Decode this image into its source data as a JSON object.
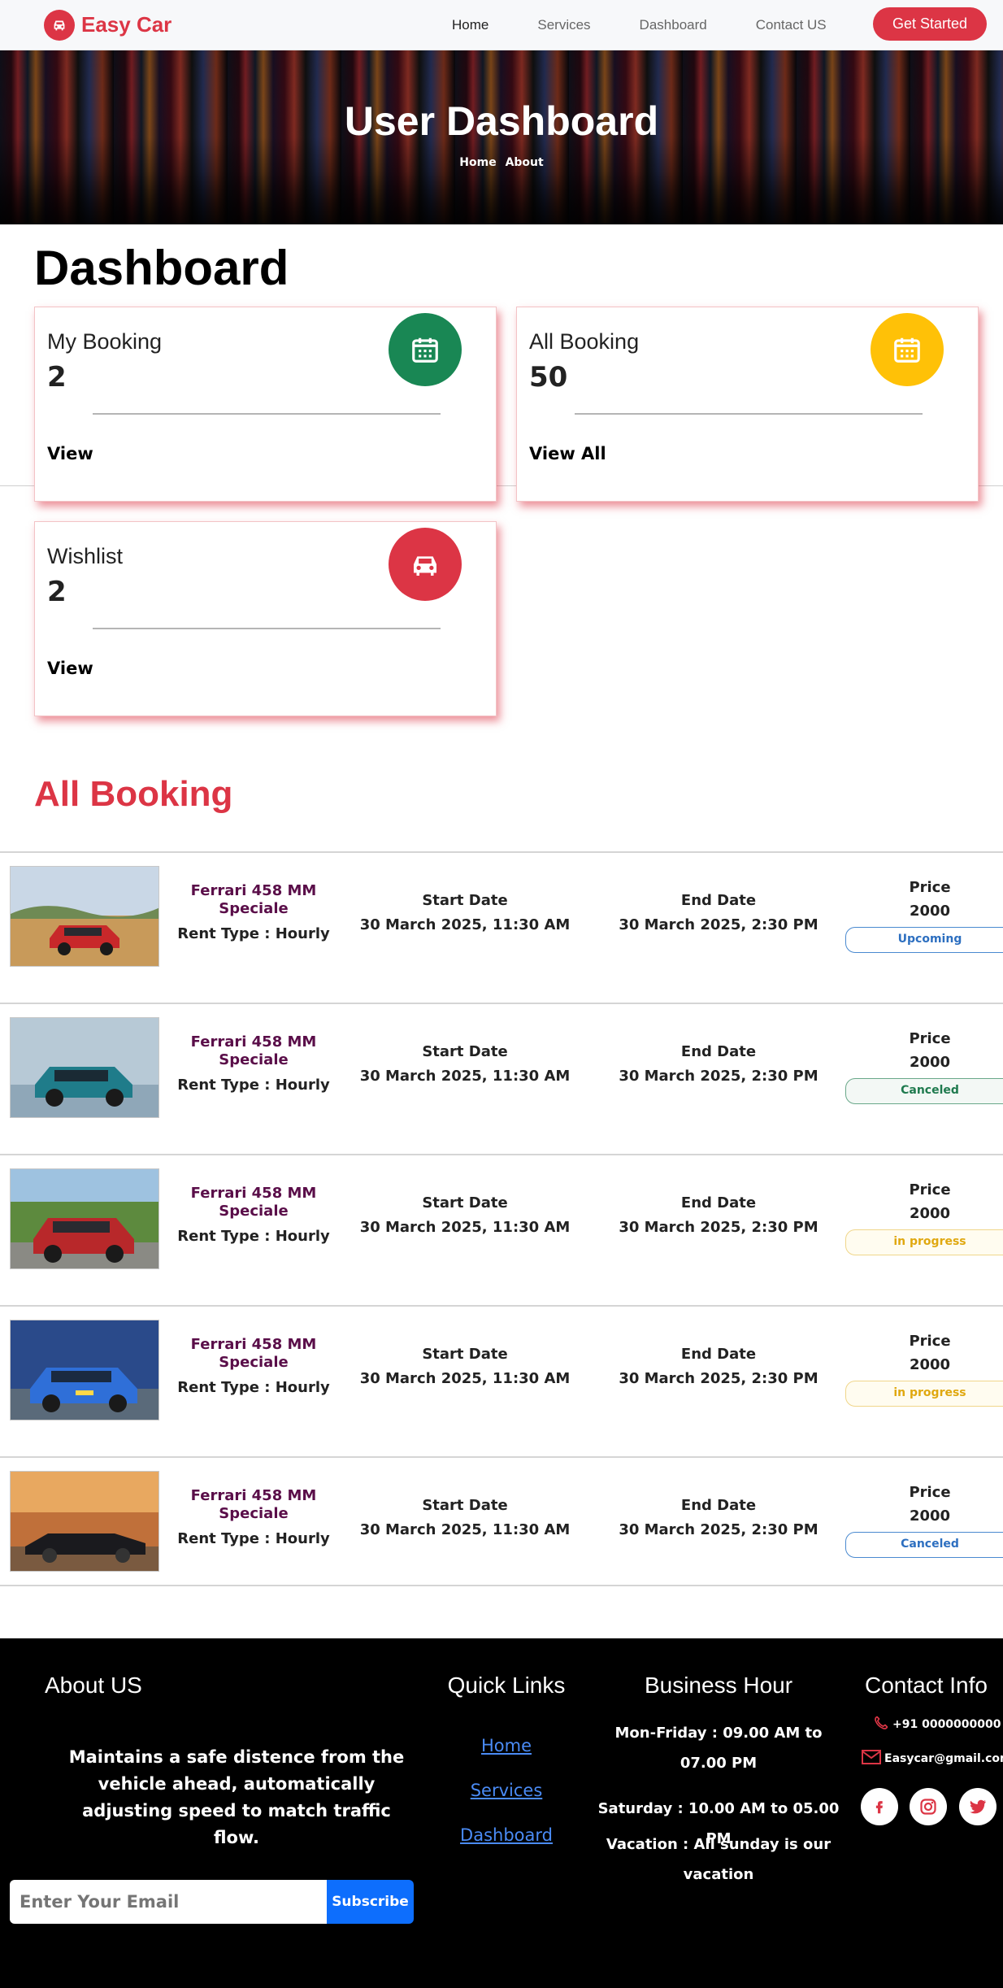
{
  "brand": {
    "name": "Easy Car"
  },
  "nav": {
    "items": [
      "Home",
      "Services",
      "Dashboard",
      "Contact US"
    ],
    "cta": "Get Started"
  },
  "hero": {
    "title": "User Dashboard",
    "crumbs": [
      "Home",
      "About"
    ]
  },
  "dashboard": {
    "title": "Dashboard",
    "cards": [
      {
        "label": "My Booking",
        "count": "2",
        "link": "View",
        "icon": "calendar-icon",
        "color": "#198754"
      },
      {
        "label": "All Booking",
        "count": "50",
        "link": "View All",
        "icon": "calendar-icon",
        "color": "#ffc107"
      },
      {
        "label": "Wishlist",
        "count": "2",
        "link": "View",
        "icon": "car-icon",
        "color": "#dc3545"
      }
    ]
  },
  "bookings": {
    "title": "All Booking",
    "start_label": "Start Date",
    "end_label": "End Date",
    "price_label": "Price",
    "rows": [
      {
        "name": "Ferrari 458 MM Speciale",
        "rent": "Rent Type : Hourly",
        "start": "30 March 2025, 11:30 AM",
        "end": "30 March 2025, 2:30 PM",
        "price": "2000",
        "status": "Upcoming",
        "status_color": "#2d6fc0"
      },
      {
        "name": "Ferrari 458 MM Speciale",
        "rent": "Rent Type : Hourly",
        "start": "30 March 2025, 11:30 AM",
        "end": "30 March 2025, 2:30 PM",
        "price": "2000",
        "status": "Canceled",
        "status_color": "#1f7a4e"
      },
      {
        "name": "Ferrari 458 MM Speciale",
        "rent": "Rent Type : Hourly",
        "start": "30 March 2025, 11:30 AM",
        "end": "30 March 2025, 2:30 PM",
        "price": "2000",
        "status": "in progress",
        "status_color": "#e0a810"
      },
      {
        "name": "Ferrari 458 MM Speciale",
        "rent": "Rent Type : Hourly",
        "start": "30 March 2025, 11:30 AM",
        "end": "30 March 2025, 2:30 PM",
        "price": "2000",
        "status": "in progress",
        "status_color": "#e0a810"
      },
      {
        "name": "Ferrari 458 MM Speciale",
        "rent": "Rent Type : Hourly",
        "start": "30 March 2025, 11:30 AM",
        "end": "30 March 2025, 2:30 PM",
        "price": "2000",
        "status": "Canceled",
        "status_color": "#2d6fc0"
      }
    ]
  },
  "footer": {
    "about_title": "About US",
    "about_text": "Maintains a safe distence from the vehicle ahead, automatically adjusting speed to match traffic flow.",
    "email_placeholder": "Enter Your Email",
    "subscribe": "Subscribe",
    "links_title": "Quick Links",
    "links": [
      "Home",
      "Services",
      "Dashboard"
    ],
    "hours_title": "Business Hour",
    "hours": [
      "Mon-Friday : 09.00 AM to 07.00 PM",
      "Saturday : 10.00 AM to 05.00 PM",
      "Vacation : All sunday is our vacation"
    ],
    "contact_title": "Contact Info",
    "phone": "+91 0000000000",
    "email": "Easycar@gmail.com",
    "socials": [
      "facebook-icon",
      "instagram-icon",
      "twitter-icon"
    ]
  },
  "colors": {
    "accent": "#dc3545",
    "success": "#198754",
    "warning": "#ffc107",
    "primary": "#0d6efd"
  }
}
